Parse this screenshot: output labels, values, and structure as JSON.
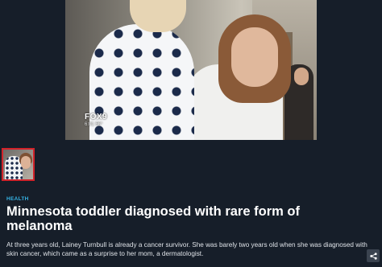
{
  "video": {
    "channel_logo": "FOX9",
    "timestamp": "6:01  56°"
  },
  "thumbnail": {
    "alt": "Minnesota toddler diagnosed with rare form of melanoma"
  },
  "article": {
    "category": "HEALTH",
    "headline": "Minnesota toddler diagnosed with rare form of melanoma",
    "summary": "At three years old, Lainey Turnbull is already a cancer survivor. She was barely two years old when she was diagnosed with skin cancer, which came as a surprise to her mom, a dermatologist."
  },
  "icons": {
    "share": "share-icon"
  },
  "colors": {
    "background": "#161e29",
    "category": "#35b4e6",
    "thumb_border": "#d2232a"
  }
}
